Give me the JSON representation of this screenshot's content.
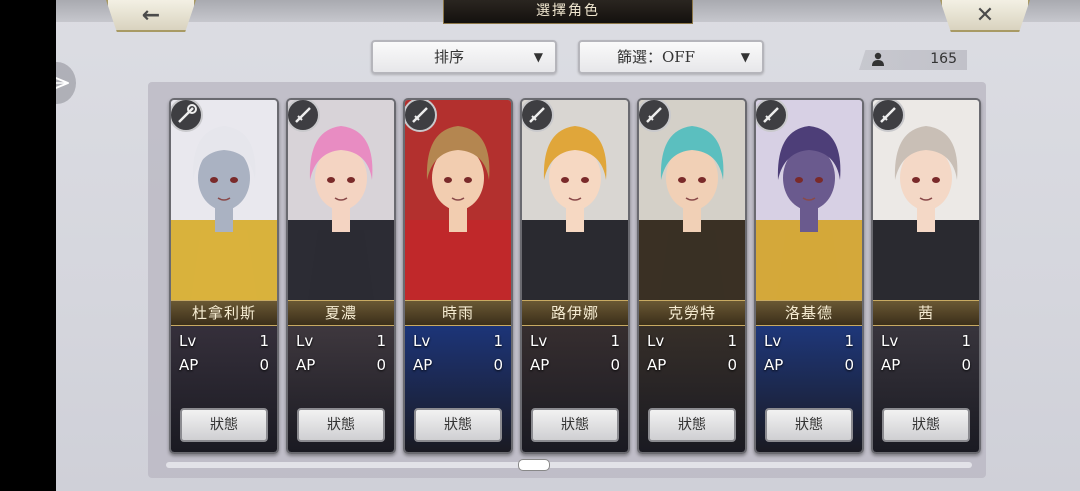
{
  "header": {
    "title": "選擇角色",
    "back_icon": "←",
    "close_icon": "✕"
  },
  "toolbar": {
    "sort_label": "排序",
    "filter_label": "篩選：OFF",
    "character_count": "165"
  },
  "stat_labels": {
    "lv": "Lv",
    "ap": "AP"
  },
  "status_button_label": "狀態",
  "characters": [
    {
      "name": "杜拿利斯",
      "lv": "1",
      "ap": "0",
      "weapon": "staff",
      "bg": "#e9e8ee",
      "hair": "#e6e6ec",
      "skin": "#aab2c2",
      "outfit": "#d9b23c",
      "lower_bg": "#3b3440"
    },
    {
      "name": "夏濃",
      "lv": "1",
      "ap": "0",
      "weapon": "sword",
      "bg": "#d8d3d8",
      "hair": "#e88cc2",
      "skin": "#f4d4c2",
      "outfit": "#2c2c34",
      "lower_bg": "#463e44"
    },
    {
      "name": "時雨",
      "lv": "1",
      "ap": "0",
      "weapon": "sword",
      "bg": "#b3302e",
      "hair": "#b48650",
      "skin": "#f2cdb0",
      "outfit": "#c0282a",
      "lower_bg": "#1d3a8a"
    },
    {
      "name": "路伊娜",
      "lv": "1",
      "ap": "0",
      "weapon": "sword",
      "bg": "#d9d6d2",
      "hair": "#e0a63a",
      "skin": "#f6d8c2",
      "outfit": "#2a2a30",
      "lower_bg": "#3c3232"
    },
    {
      "name": "克勞特",
      "lv": "1",
      "ap": "0",
      "weapon": "sword",
      "bg": "#d4d0c8",
      "hair": "#5bbfbf",
      "skin": "#f1d0b6",
      "outfit": "#3a3024",
      "lower_bg": "#3c332a"
    },
    {
      "name": "洛基德",
      "lv": "1",
      "ap": "0",
      "weapon": "sword",
      "bg": "#d7d0e4",
      "hair": "#4d3e78",
      "skin": "#6a5a8e",
      "outfit": "#d4a83a",
      "lower_bg": "#1f3d8c"
    },
    {
      "name": "茜",
      "lv": "1",
      "ap": "0",
      "weapon": "sword",
      "bg": "#ece9e6",
      "hair": "#c9bfb6",
      "skin": "#f4d8c6",
      "outfit": "#2a2a30",
      "lower_bg": "#3e3a42"
    }
  ]
}
